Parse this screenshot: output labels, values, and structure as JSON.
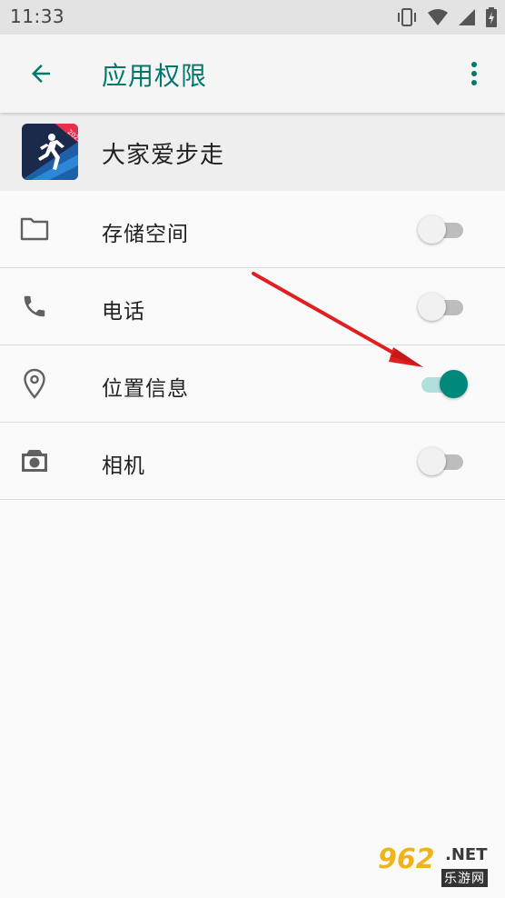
{
  "status_bar": {
    "time": "11:33",
    "icons": [
      "vibrate-icon",
      "wifi-icon",
      "signal-icon",
      "battery-charging-icon"
    ]
  },
  "app_bar": {
    "title": "应用权限",
    "back_icon": "arrow-back-icon",
    "more_icon": "more-vert-icon",
    "accent_color": "#00796b"
  },
  "app": {
    "name": "大家爱步走",
    "icon": "runner-app-icon"
  },
  "permissions": [
    {
      "label": "存储空间",
      "icon": "folder-icon",
      "enabled": false
    },
    {
      "label": "电话",
      "icon": "phone-icon",
      "enabled": false
    },
    {
      "label": "位置信息",
      "icon": "location-icon",
      "enabled": true
    },
    {
      "label": "相机",
      "icon": "camera-icon",
      "enabled": false
    }
  ],
  "annotation": {
    "type": "red-arrow",
    "points_to": "位置信息 switch",
    "color": "#e02020"
  },
  "watermark": {
    "main": "962",
    "suffix": ".NET",
    "sub": "乐游网"
  }
}
